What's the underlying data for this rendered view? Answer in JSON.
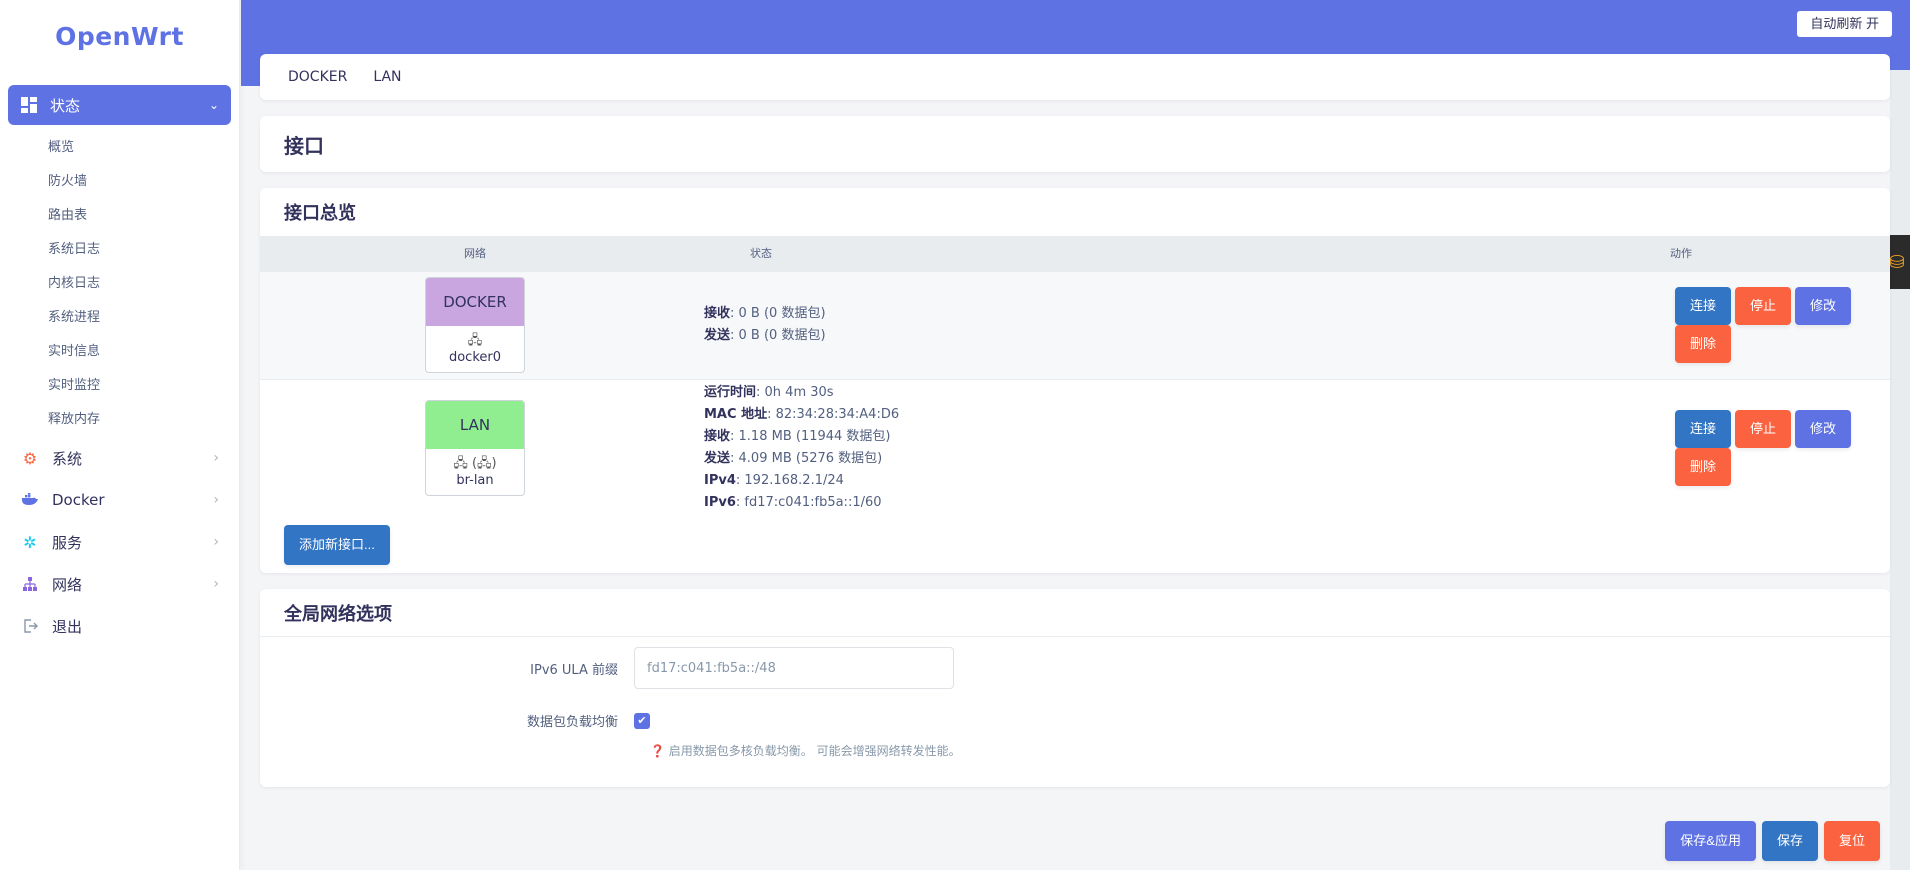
{
  "brand": {
    "logo": "OpenWrt",
    "accent": "#5e72e4"
  },
  "sidebar": {
    "active": {
      "label": "状态",
      "icon": "dashboard-icon"
    },
    "sub_items": [
      "概览",
      "防火墙",
      "路由表",
      "系统日志",
      "内核日志",
      "系统进程",
      "实时信息",
      "实时监控",
      "释放内存"
    ],
    "items": [
      {
        "label": "系统",
        "icon": "gear-icon"
      },
      {
        "label": "Docker",
        "icon": "docker-icon"
      },
      {
        "label": "服务",
        "icon": "services-icon"
      },
      {
        "label": "网络",
        "icon": "network-icon"
      },
      {
        "label": "退出",
        "icon": "logout-icon"
      }
    ]
  },
  "header": {
    "refresh_label": "自动刷新 开"
  },
  "tabs": [
    "DOCKER",
    "LAN"
  ],
  "page_title": "接口",
  "interfaces": {
    "section_title": "接口总览",
    "columns": {
      "network": "网络",
      "status": "状态",
      "actions": "动作"
    },
    "rows": [
      {
        "name": "DOCKER",
        "head_color": "#c9a6e0",
        "device": "docker0",
        "device_icon": "🖧",
        "status": [
          {
            "label": "接收",
            "value": ": 0 B (0 数据包)"
          },
          {
            "label": "发送",
            "value": ": 0 B (0 数据包)"
          }
        ]
      },
      {
        "name": "LAN",
        "head_color": "#90ee90",
        "device": "br-lan",
        "device_icon": "🖧 (🖧)",
        "status": [
          {
            "label": "运行时间",
            "value": ": 0h 4m 30s"
          },
          {
            "label": "MAC 地址",
            "value": ": 82:34:28:34:A4:D6"
          },
          {
            "label": "接收",
            "value": ": 1.18 MB (11944 数据包)"
          },
          {
            "label": "发送",
            "value": ": 4.09 MB (5276 数据包)"
          },
          {
            "label": "IPv4",
            "value": ": 192.168.2.1/24"
          },
          {
            "label": "IPv6",
            "value": ": fd17:c041:fb5a::1/60"
          }
        ]
      }
    ],
    "actions": {
      "connect": "连接",
      "stop": "停止",
      "edit": "修改",
      "delete": "删除"
    },
    "add_label": "添加新接口..."
  },
  "global": {
    "section_title": "全局网络选项",
    "ula_label": "IPv6 ULA 前缀",
    "ula_value": "fd17:c041:fb5a::/48",
    "balance_label": "数据包负载均衡",
    "balance_checked": true,
    "balance_hint": "启用数据包多核负载均衡。 可能会增强网络转发性能。"
  },
  "footer": {
    "save_apply": "保存&应用",
    "save": "保存",
    "reset": "复位"
  }
}
